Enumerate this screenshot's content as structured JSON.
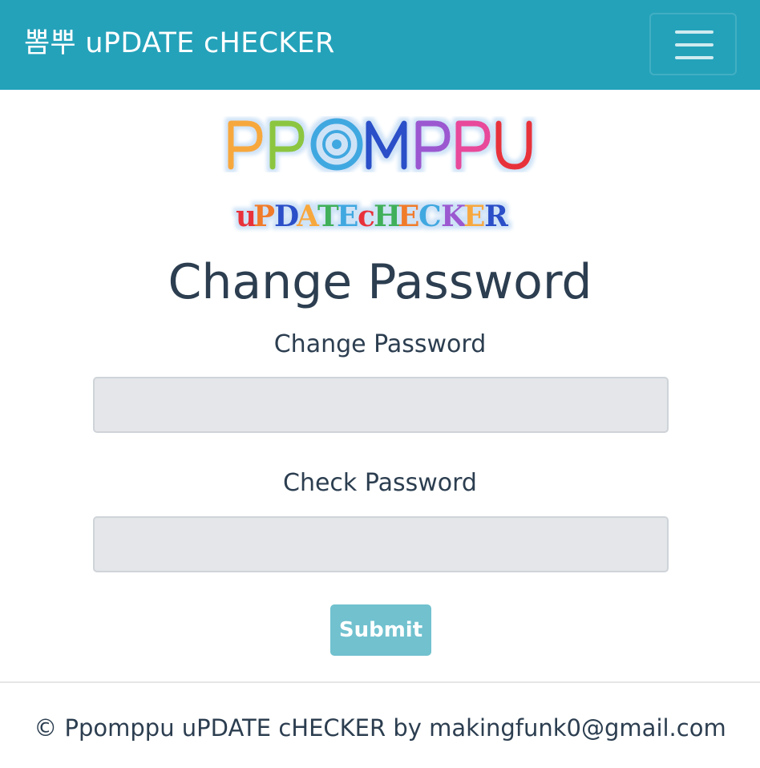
{
  "navbar": {
    "brand": "뽐뿌 uPDATE cHECKER",
    "menu_icon": "hamburger-menu-icon",
    "color": "#24a2ba"
  },
  "logo": {
    "line1": "PPOMPPU",
    "line2": "uPDATE cHECKER"
  },
  "page": {
    "title": "Change Password"
  },
  "form": {
    "password_label": "Change Password",
    "password_value": "",
    "check_label": "Check Password",
    "check_value": "",
    "submit_label": "Submit",
    "submit_color": "#71c1cf"
  },
  "footer": {
    "text": "© Ppomppu uPDATE cHECKER by makingfunk0@gmail.com"
  }
}
